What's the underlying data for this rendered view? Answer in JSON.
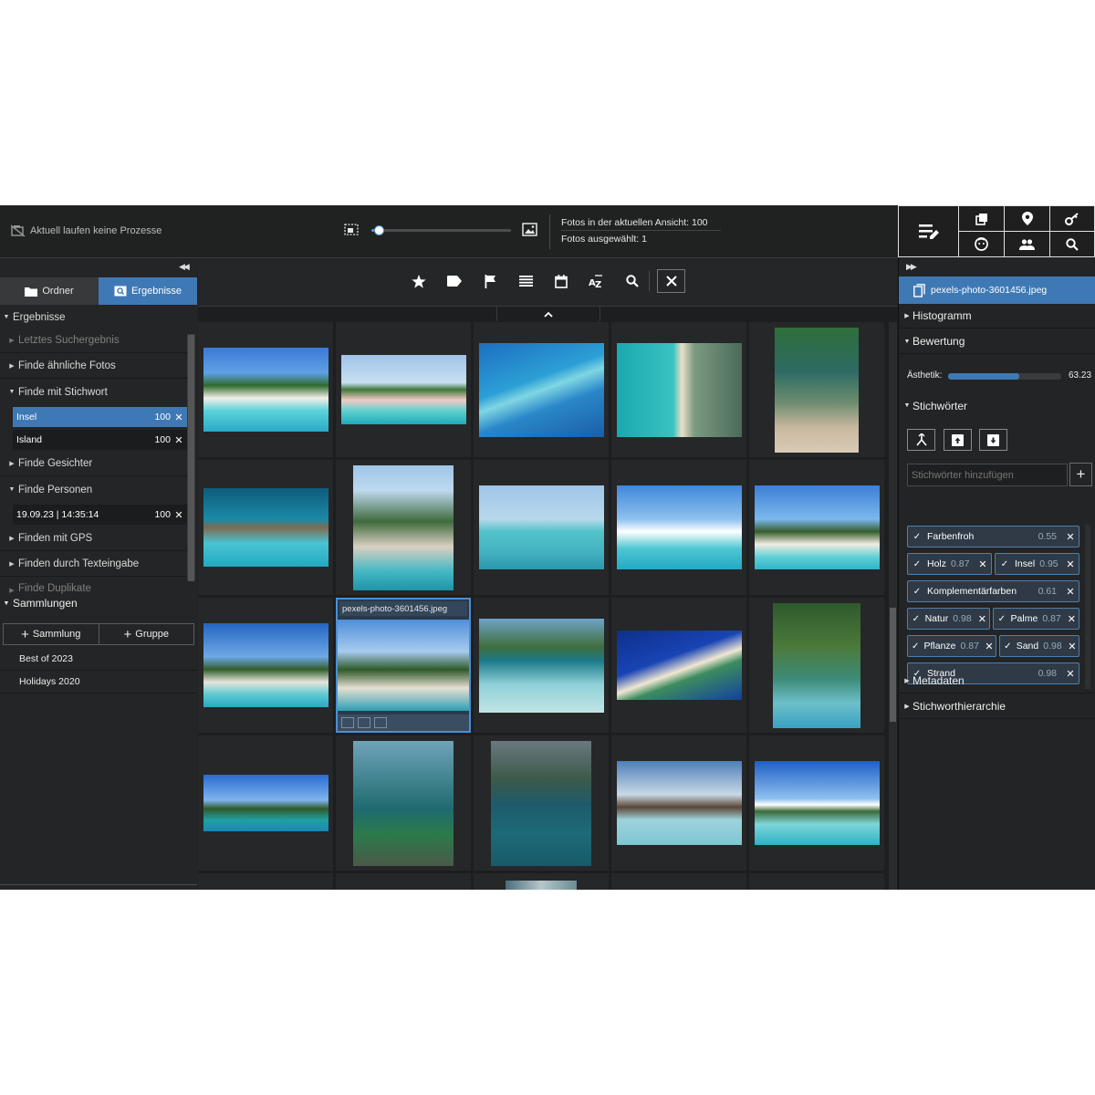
{
  "topbar": {
    "process_status": "Aktuell laufen keine Prozesse",
    "zoom_value": 0.05,
    "photos_in_view": "Fotos in der aktuellen Ansicht: 100",
    "photos_selected": "Fotos ausgewählt: 1"
  },
  "left": {
    "tabs": [
      {
        "label": "Ordner",
        "icon": "folder-icon",
        "active": false
      },
      {
        "label": "Ergebnisse",
        "icon": "search-result-icon",
        "active": true
      }
    ],
    "results_header": "Ergebnisse",
    "items": {
      "last_search": "Letztes Suchergebnis",
      "similar": "Finde ähnliche Fotos",
      "keyword": "Finde mit Stichwort",
      "faces": "Finde Gesichter",
      "persons": "Finde Personen",
      "gps": "Finden mit GPS",
      "text": "Finden durch Texteingabe",
      "duplicates": "Finde Duplikate"
    },
    "keyword_results": [
      {
        "label": "Insel",
        "count": "100",
        "close": "✕"
      },
      {
        "label": "Island",
        "count": "100",
        "close": "✕"
      }
    ],
    "person_results": [
      {
        "label": "19.09.23 | 14:35:14",
        "count": "100",
        "close": "✕"
      }
    ],
    "collections_header": "Sammlungen",
    "add_collection": "Sammlung",
    "add_group": "Gruppe",
    "collections": [
      "Best of 2023",
      "Holidays 2020"
    ]
  },
  "center": {
    "toolbar_icons": [
      "star-icon",
      "tag-icon",
      "flag-icon",
      "list-icon",
      "calendar-icon",
      "sort-az-icon",
      "search-icon",
      "close-icon"
    ],
    "selected_photo_name": "pexels-photo-3601456.jpeg"
  },
  "right": {
    "file_name": "pexels-photo-3601456.jpeg",
    "sections": {
      "histogram": "Histogramm",
      "rating": "Bewertung",
      "keywords": "Stichwörter",
      "metadata": "Metadaten",
      "hierarchy": "Stichworthierarchie"
    },
    "aesthetic_label": "Ästhetik:",
    "aesthetic_value": "63.23",
    "aesthetic_fraction": 0.63,
    "keyword_placeholder": "Stichwörter hinzufügen",
    "keywords": [
      {
        "label": "Farbenfroh",
        "score": "0.55"
      },
      {
        "label": "Holz",
        "score": "0.87"
      },
      {
        "label": "Insel",
        "score": "0.95"
      },
      {
        "label": "Komplementärfarben",
        "score": "0.61"
      },
      {
        "label": "Natur",
        "score": "0.98"
      },
      {
        "label": "Palme",
        "score": "0.87"
      },
      {
        "label": "Pflanze",
        "score": "0.87"
      },
      {
        "label": "Sand",
        "score": "0.98"
      },
      {
        "label": "Strand",
        "score": "0.98"
      }
    ]
  }
}
